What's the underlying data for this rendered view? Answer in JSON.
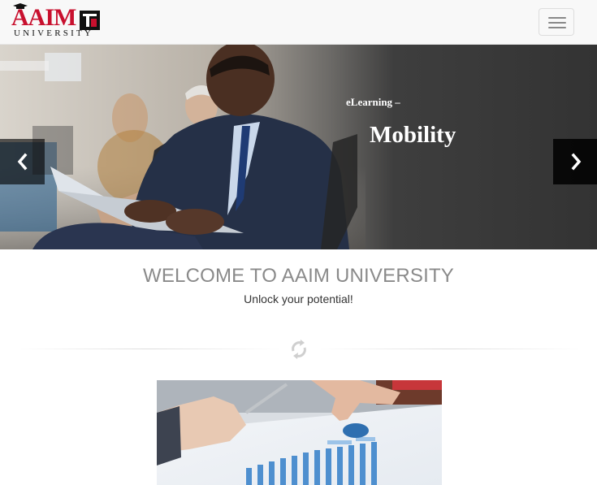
{
  "brand": {
    "logo_text": "AAIM",
    "logo_subtext": "UNIVERSITY",
    "accent": "#c8102e"
  },
  "navbar": {
    "toggle_icon": "hamburger-icon"
  },
  "carousel": {
    "caption_small": "eLearning –",
    "caption_big": "Mobility",
    "prev_icon": "chevron-left-icon",
    "next_icon": "chevron-right-icon"
  },
  "welcome": {
    "title": "WELCOME TO AAIM UNIVERSITY",
    "subtitle": "Unlock your potential!",
    "divider_icon": "refresh-icon"
  }
}
